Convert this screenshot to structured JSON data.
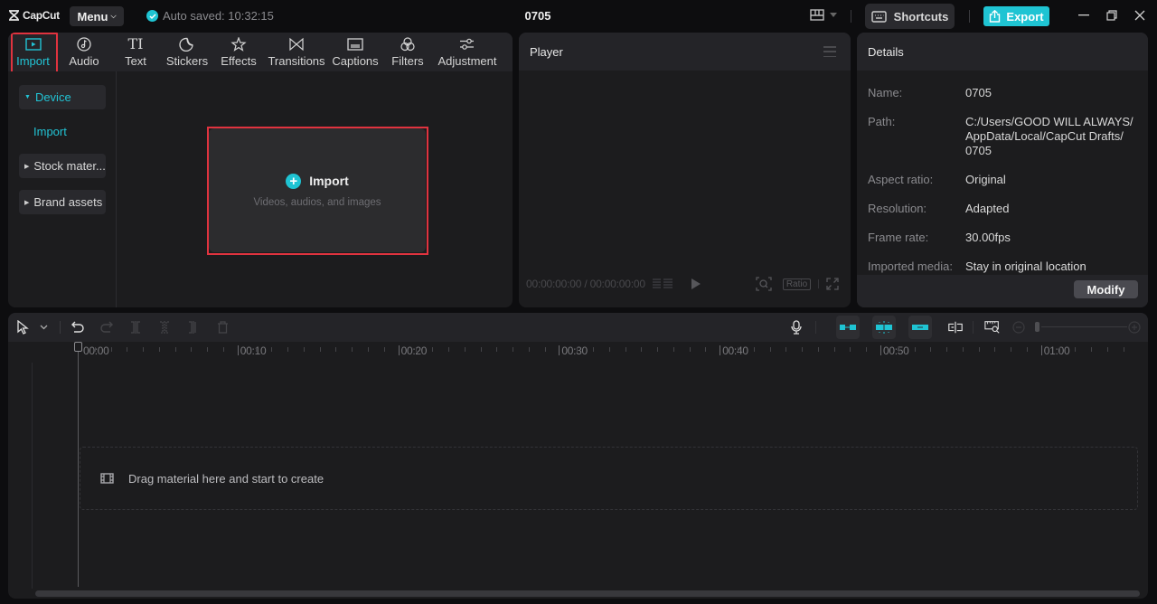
{
  "app": {
    "logo_text": "CapCut",
    "menu_label": "Menu",
    "autosave_text": "Auto saved: 10:32:15",
    "project_title": "0705",
    "shortcuts_label": "Shortcuts",
    "export_label": "Export",
    "accent_color": "#1fc4d3",
    "highlight_color": "#e0333f"
  },
  "toolbar_tabs": [
    {
      "label": "Import",
      "icon": "media-import-icon",
      "active": true
    },
    {
      "label": "Audio",
      "icon": "music-note-icon",
      "active": false
    },
    {
      "label": "Text",
      "icon": "text-icon",
      "active": false
    },
    {
      "label": "Stickers",
      "icon": "sticker-icon",
      "active": false
    },
    {
      "label": "Effects",
      "icon": "sparkle-star-icon",
      "active": false
    },
    {
      "label": "Transitions",
      "icon": "bowtie-transition-icon",
      "active": false
    },
    {
      "label": "Captions",
      "icon": "caption-icon",
      "active": false
    },
    {
      "label": "Filters",
      "icon": "filters-circles-icon",
      "active": false
    },
    {
      "label": "Adjustment",
      "icon": "sliders-icon",
      "active": false
    }
  ],
  "side_nav": {
    "device_label": "Device",
    "device_sub_import": "Import",
    "stock_label": "Stock mater...",
    "brand_label": "Brand assets"
  },
  "import_box": {
    "title": "Import",
    "subtitle": "Videos, audios, and images"
  },
  "player": {
    "title": "Player",
    "current_time": "00:00:00:00",
    "total_time": "00:00:00:00",
    "ratio_label": "Ratio"
  },
  "details": {
    "title": "Details",
    "rows": [
      {
        "label": "Name:",
        "value": "0705"
      },
      {
        "label": "Path:",
        "value": "C:/Users/GOOD WILL ALWAYS/ AppData/Local/CapCut Drafts/ 0705"
      },
      {
        "label": "Aspect ratio:",
        "value": "Original"
      },
      {
        "label": "Resolution:",
        "value": "Adapted"
      },
      {
        "label": "Frame rate:",
        "value": "30.00fps"
      },
      {
        "label": "Imported media:",
        "value": "Stay in original location"
      }
    ],
    "modify_label": "Modify"
  },
  "timeline": {
    "ruler_labels": [
      "00:00",
      "00:10",
      "00:20",
      "00:30",
      "00:40",
      "00:50",
      "01:00"
    ],
    "drop_text": "Drag material here and start to create"
  }
}
